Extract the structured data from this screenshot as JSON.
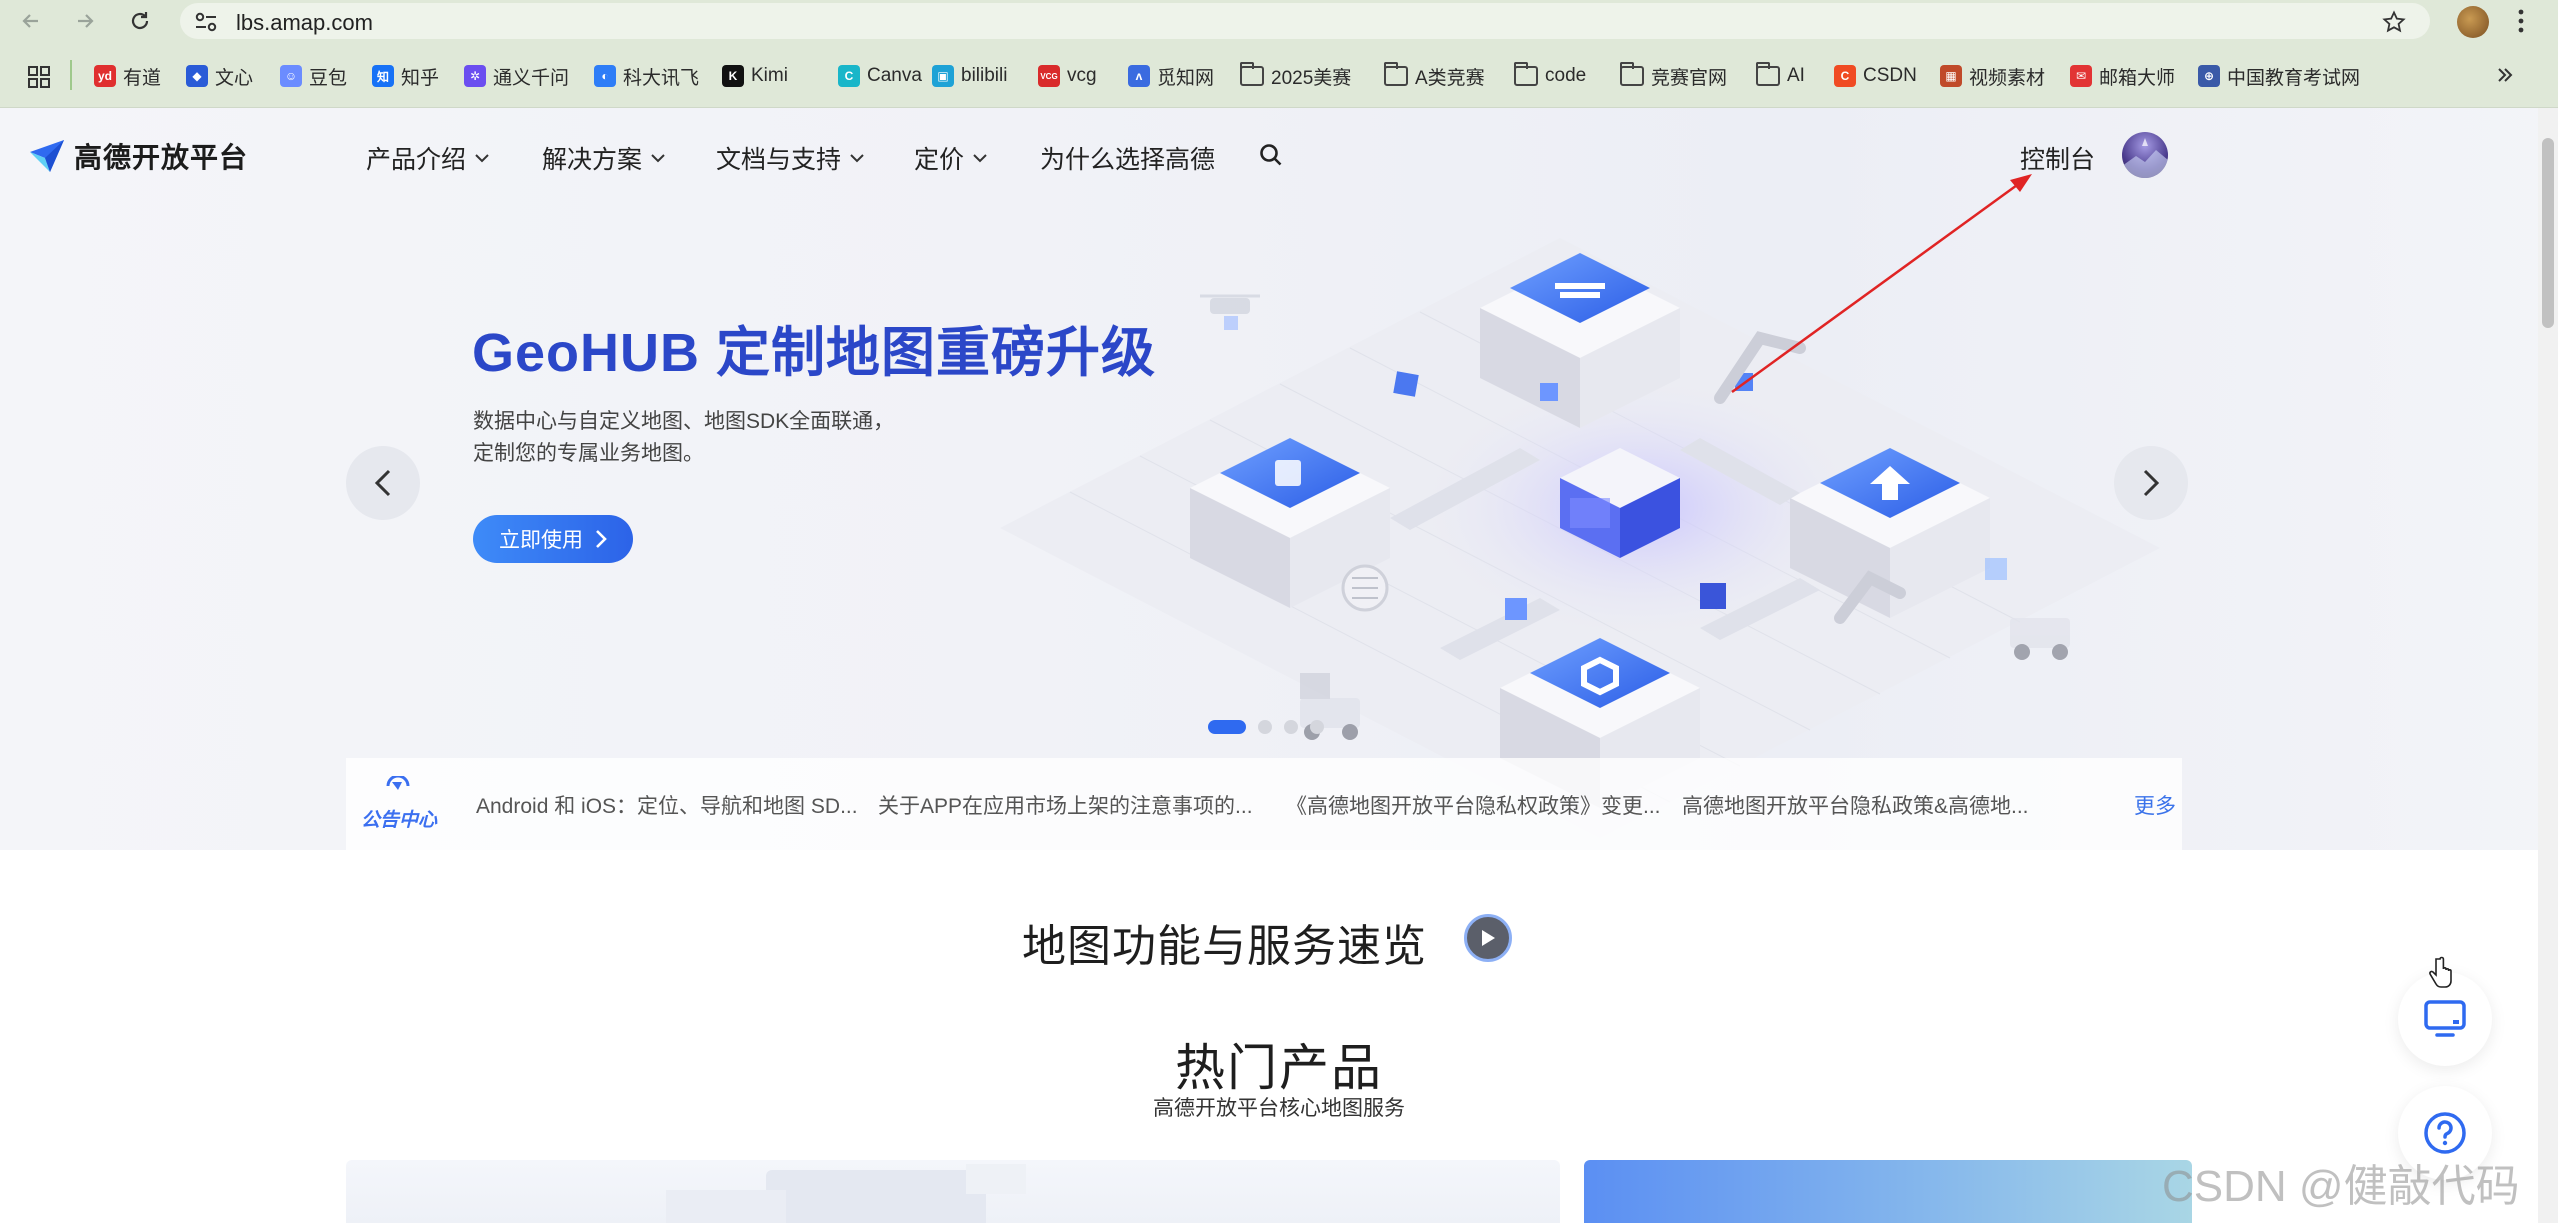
{
  "browser": {
    "url": "lbs.amap.com",
    "bookmarks": [
      {
        "label": "有道",
        "icon": "youdao-icon",
        "color": "#e02f2f",
        "glyph": "yd"
      },
      {
        "label": "文心",
        "icon": "wenxin-icon",
        "color": "#2a5bd7",
        "glyph": "◆"
      },
      {
        "label": "豆包",
        "icon": "doubao-icon",
        "color": "#6b8cff",
        "glyph": "☺"
      },
      {
        "label": "知乎",
        "icon": "zhihu-icon",
        "color": "#1772f6",
        "glyph": "知"
      },
      {
        "label": "通义千问",
        "icon": "tongyi-icon",
        "color": "#6b4ef0",
        "glyph": "✲"
      },
      {
        "label": "科大讯飞",
        "icon": "xunfei-icon",
        "color": "#2e7df7",
        "glyph": "◐"
      },
      {
        "label": "Kimi",
        "icon": "kimi-icon",
        "color": "#111111",
        "glyph": "K"
      },
      {
        "label": "Canva",
        "icon": "canva-icon",
        "color": "#19b6c9",
        "glyph": "C"
      },
      {
        "label": "bilibili",
        "icon": "bilibili-icon",
        "color": "#1ea2d6",
        "glyph": "▣"
      },
      {
        "label": "vcg",
        "icon": "vcg-icon",
        "color": "#d92b2b",
        "glyph": "VCG"
      },
      {
        "label": "觅知网",
        "icon": "mizhi-icon",
        "color": "#3a6be0",
        "glyph": "ʌ"
      },
      {
        "label": "2025美赛",
        "icon": "folder-icon",
        "color": "",
        "glyph": ""
      },
      {
        "label": "A类竞赛",
        "icon": "folder-icon",
        "color": "",
        "glyph": ""
      },
      {
        "label": "code",
        "icon": "folder-icon",
        "color": "",
        "glyph": ""
      },
      {
        "label": "竞赛官网",
        "icon": "folder-icon",
        "color": "",
        "glyph": ""
      },
      {
        "label": "AI",
        "icon": "folder-icon",
        "color": "",
        "glyph": ""
      },
      {
        "label": "CSDN",
        "icon": "csdn-icon",
        "color": "#f04b23",
        "glyph": "C"
      },
      {
        "label": "视频素材",
        "icon": "video-material-icon",
        "color": "#c04a2a",
        "glyph": "▦"
      },
      {
        "label": "邮箱大师",
        "icon": "mail-master-icon",
        "color": "#e23434",
        "glyph": "✉"
      },
      {
        "label": "中国教育考试网",
        "icon": "neea-icon",
        "color": "#3a5aa8",
        "glyph": "⊕"
      }
    ]
  },
  "header": {
    "logo_text": "高德开放平台",
    "nav": [
      "产品介绍",
      "解决方案",
      "文档与支持",
      "定价",
      "为什么选择高德"
    ],
    "console": "控制台"
  },
  "hero": {
    "title": "GeoHUB 定制地图重磅升级",
    "desc_line1": "数据中心与自定义地图、地图SDK全面联通，",
    "desc_line2": "定制您的专属业务地图。",
    "cta": "立即使用",
    "slide_count": 4,
    "active_slide": 1,
    "accent_color": "#2b47c8"
  },
  "notice": {
    "badge": "公告中心",
    "items": [
      "Android 和 iOS：定位、导航和地图 SD...",
      "关于APP在应用市场上架的注意事项的...",
      "《高德地图开放平台隐私权政策》变更...",
      "高德地图开放平台隐私政策&高德地..."
    ],
    "more": "更多"
  },
  "sections": {
    "overview_title": "地图功能与服务速览",
    "hot_title": "热门产品",
    "hot_subtitle": "高德开放平台核心地图服务"
  },
  "watermark": "CSDN @健敲代码"
}
